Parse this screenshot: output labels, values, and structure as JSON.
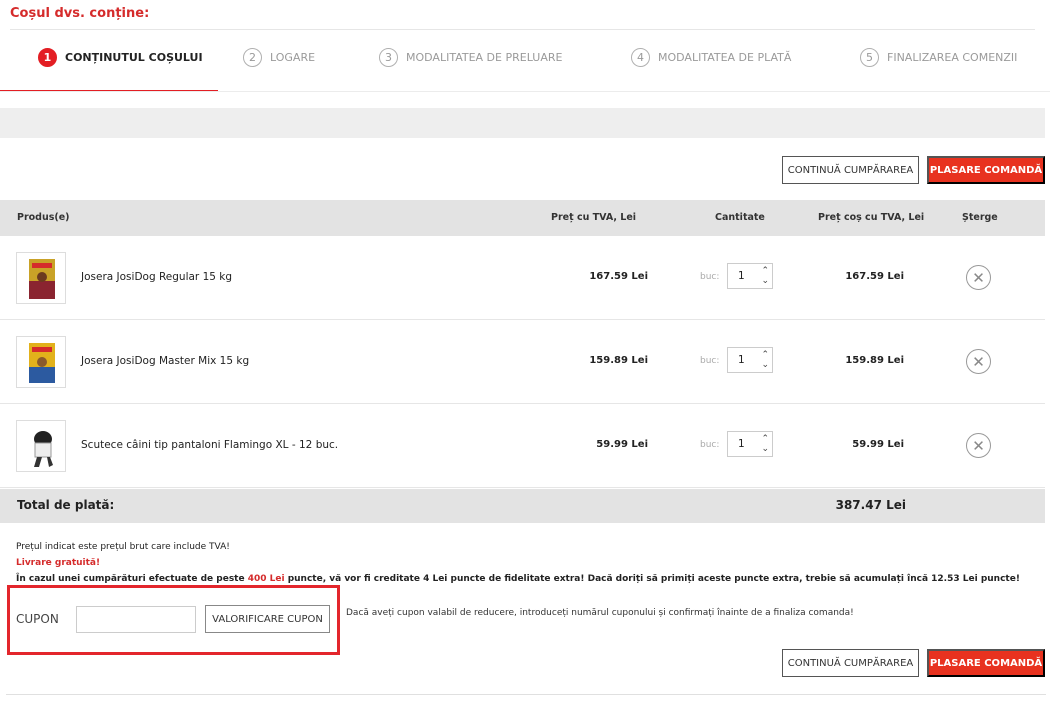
{
  "page_title": "Coșul dvs. conține:",
  "steps": [
    {
      "num": "1",
      "label": "CONȚINUTUL COȘULUI"
    },
    {
      "num": "2",
      "label": "LOGARE"
    },
    {
      "num": "3",
      "label": "MODALITATEA DE PRELUARE"
    },
    {
      "num": "4",
      "label": "MODALITATEA DE PLATĂ"
    },
    {
      "num": "5",
      "label": "FINALIZAREA COMENZII"
    }
  ],
  "buttons": {
    "continue": "CONTINUĂ CUMPĂRAREA",
    "place_order": "PLASARE COMANDĂ",
    "validate_coupon": "VALORIFICARE CUPON"
  },
  "table": {
    "headers": {
      "product": "Produs(e)",
      "price": "Preț cu TVA, Lei",
      "qty": "Cantitate",
      "cart_price": "Preț coș cu TVA, Lei",
      "delete": "Șterge"
    },
    "rows": [
      {
        "name": "Josera JosiDog Regular 15 kg",
        "price": "167.59 Lei",
        "unit": "buc:",
        "qty": "1",
        "total": "167.59 Lei"
      },
      {
        "name": "Josera JosiDog Master Mix 15 kg",
        "price": "159.89 Lei",
        "unit": "buc:",
        "qty": "1",
        "total": "159.89 Lei"
      },
      {
        "name": "Scutece câini tip pantaloni Flamingo XL - 12 buc.",
        "price": "59.99 Lei",
        "unit": "buc:",
        "qty": "1",
        "total": "59.99 Lei"
      }
    ]
  },
  "total": {
    "label": "Total de plată:",
    "value": "387.47 Lei"
  },
  "notes": {
    "vat": "Prețul indicat este prețul brut care include TVA!",
    "free_delivery": "Livrare gratuită!",
    "points_1": "În cazul unei cumpărături efectuate de peste ",
    "points_amount": "400 Lei",
    "points_2": " puncte, vă vor fi creditate 4 Lei puncte de fidelitate extra! Dacă doriți să primiți aceste puncte extra, trebie să acumulați încă 12.53 Lei puncte!"
  },
  "coupon": {
    "label": "CUPON",
    "value": "",
    "hint": "Dacă aveți cupon valabil de reducere, introduceți numărul cuponului și confirmați înainte de a finaliza comanda!"
  },
  "colors": {
    "accent": "#e31e24",
    "button_red": "#e8321f",
    "highlight_box": "#e3262c"
  }
}
